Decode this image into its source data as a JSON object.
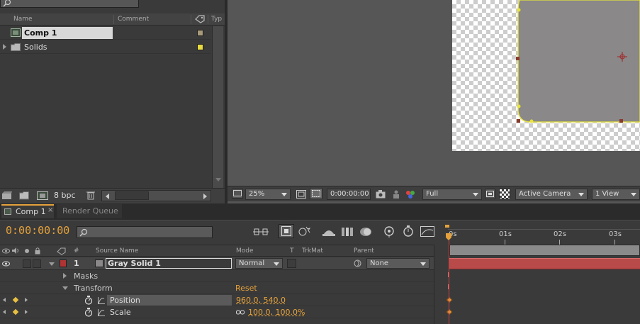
{
  "project": {
    "columns": {
      "name": "Name",
      "comment": "Comment",
      "type": "Typ"
    },
    "items": [
      {
        "label": "Comp 1",
        "color": "#a89a7a"
      },
      {
        "label": "Solids",
        "color": "#e8dc40"
      }
    ],
    "bpc": "8 bpc"
  },
  "viewer": {
    "zoom": "25%",
    "timecode": "0:00:00:00",
    "resolution": "Full",
    "camera": "Active Camera",
    "views": "1 View"
  },
  "tabs": [
    {
      "label": "Comp 1"
    },
    {
      "label": "Render Queue"
    }
  ],
  "timeline": {
    "timecode": "0:00:00:00",
    "search_placeholder": "",
    "headers": {
      "num": "#",
      "source": "Source Name",
      "mode": "Mode",
      "t": "T",
      "trkmat": "TrkMat",
      "parent": "Parent"
    },
    "ruler": [
      "0s",
      "01s",
      "02s",
      "03s"
    ],
    "layer": {
      "num": "1",
      "name": "Gray Solid 1",
      "mode": "Normal",
      "parent": "None",
      "label_color": "#b03434"
    },
    "groups": {
      "masks": "Masks",
      "transform": "Transform",
      "reset": "Reset"
    },
    "props": [
      {
        "name": "Position",
        "value": "960.0, 540.0"
      },
      {
        "name": "Scale",
        "value": "100.0, 100.0%"
      }
    ]
  },
  "colors": {
    "accent": "#e6a23a",
    "track": "#b84a4a",
    "selection": "#d8d8d8"
  }
}
